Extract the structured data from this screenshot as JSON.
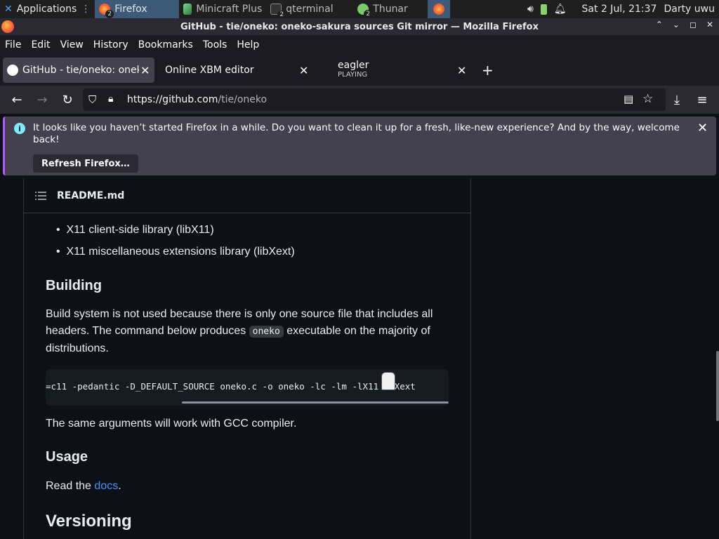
{
  "taskbar": {
    "applications": "Applications",
    "items": [
      {
        "label": "Firefox",
        "badge": "2"
      },
      {
        "label": "Minicraft Plus",
        "badge": ""
      },
      {
        "label": "qterminal",
        "badge": "2"
      },
      {
        "label": "Thunar",
        "badge": "2"
      }
    ],
    "clock": "Sat  2 Jul, 21:37",
    "user": "Darty uwu"
  },
  "window": {
    "title": "GitHub - tie/oneko: oneko-sakura sources Git mirror — Mozilla Firefox"
  },
  "menu": [
    "File",
    "Edit",
    "View",
    "History",
    "Bookmarks",
    "Tools",
    "Help"
  ],
  "tabs": [
    {
      "label": "GitHub - tie/oneko: oneko-s",
      "sub": ""
    },
    {
      "label": "Online XBM editor",
      "sub": ""
    },
    {
      "label": "eagler",
      "sub": "PLAYING"
    }
  ],
  "url": {
    "host": "https://github.com",
    "path": "/tie/oneko"
  },
  "notification": {
    "text": "It looks like you haven’t started Firefox in a while. Do you want to clean it up for a fresh, like-new experience? And by the way, welcome back!",
    "button": "Refresh Firefox…"
  },
  "readme": {
    "file": "README.md",
    "bullets": [
      "X11 client-side library (libX11)",
      "X11 miscellaneous extensions library (libXext)"
    ],
    "building_heading": "Building",
    "building_p1": "Build system is not used because there is only one source file that includes all headers. The command below produces",
    "building_code": "oneko",
    "building_p2": "executable on the majority of distributions.",
    "codeblock": "=c11 -pedantic -D_DEFAULT_SOURCE oneko.c -o oneko -lc -lm -lX11 -lXext",
    "gcc_note": "The same arguments will work with GCC compiler.",
    "usage_heading": "Usage",
    "usage_text": "Read the",
    "usage_link": "docs",
    "usage_end": ".",
    "versioning_heading": "Versioning"
  }
}
